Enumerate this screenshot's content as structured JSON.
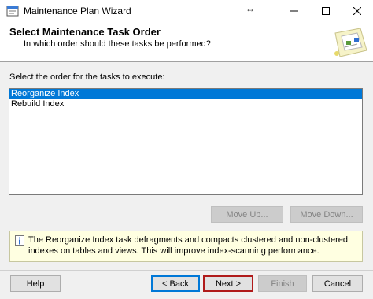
{
  "window": {
    "title": "Maintenance Plan Wizard"
  },
  "header": {
    "title": "Select Maintenance Task Order",
    "subtitle": "In which order should these tasks be performed?"
  },
  "task_order": {
    "instruction": "Select the order for the tasks to execute:",
    "items": [
      "Reorganize Index",
      "Rebuild Index"
    ],
    "selected_index": 0
  },
  "buttons": {
    "move_up": "Move Up...",
    "move_down": "Move Down...",
    "help": "Help",
    "back": "< Back",
    "next": "Next >",
    "finish": "Finish",
    "cancel": "Cancel"
  },
  "info": {
    "text": "The Reorganize Index task defragments and compacts clustered and non-clustered indexes on tables and views. This will improve index-scanning performance."
  },
  "icons": {
    "app": "wizard-icon",
    "info": "info-icon",
    "header_art": "wizard-art-icon",
    "resize": "resize-arrows-icon"
  },
  "colors": {
    "selection": "#0078d7",
    "info_background": "#ffffe1"
  }
}
